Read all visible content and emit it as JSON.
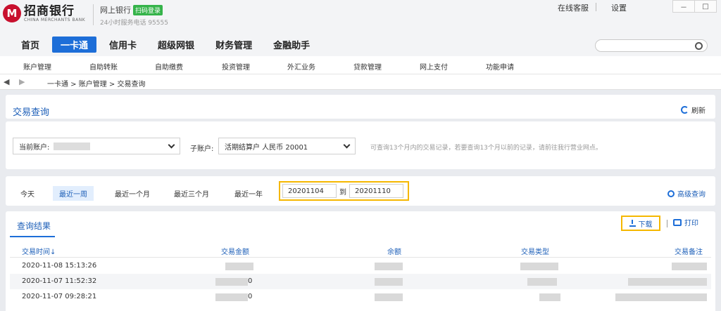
{
  "header": {
    "bank_name": "招商银行",
    "bank_english": "CHINA MERCHANTS BANK",
    "logo_letter": "M",
    "netbank_title": "网上银行",
    "scan_login": "扫码登录",
    "service_phone": "24小时服务电话 95555",
    "online_service": "在线客服",
    "settings": "设置",
    "minimize": "－",
    "maximize": "□"
  },
  "nav": {
    "items": [
      "首页",
      "一卡通",
      "信用卡",
      "超级网银",
      "财务管理",
      "金融助手"
    ],
    "active_index": 1
  },
  "subnav": {
    "items": [
      "账户管理",
      "自助转账",
      "自助缴费",
      "投资管理",
      "外汇业务",
      "贷款管理",
      "网上支付",
      "功能申请"
    ]
  },
  "breadcrumb": {
    "back": "◀",
    "forward": "▶",
    "path": "一卡通 > 账户管理 > 交易查询"
  },
  "page": {
    "title": "交易查询",
    "refresh_label": "刷新"
  },
  "filters": {
    "current_account_label": "当前账户:",
    "sub_account_label": "子账户:",
    "sub_account_value": "活期结算户 人民币 20001",
    "hint": "可查询13个月内的交易记录，若要查询13个月以前的记录，请前往我行营业网点。"
  },
  "date_range": {
    "options": [
      "今天",
      "最近一周",
      "最近一个月",
      "最近三个月",
      "最近一年"
    ],
    "active_index": 1,
    "start_date": "20201104",
    "to_label": "到",
    "end_date": "20201110",
    "advanced_search": "高级查询"
  },
  "results": {
    "tab_label": "查询结果",
    "download_label": "下载",
    "print_label": "打印",
    "columns": [
      "交易时间↓",
      "交易金额",
      "余额",
      "交易类型",
      "交易备注"
    ],
    "rows": [
      {
        "time": "2020-11-08  15:13:26",
        "amount_tail": ""
      },
      {
        "time": "2020-11-07  11:52:32",
        "amount_tail": "0"
      },
      {
        "time": "2020-11-07  09:28:21",
        "amount_tail": "0"
      }
    ]
  },
  "colors": {
    "accent": "#1d6ed8",
    "highlight": "#f5b700",
    "brand_red": "#c8102e"
  }
}
